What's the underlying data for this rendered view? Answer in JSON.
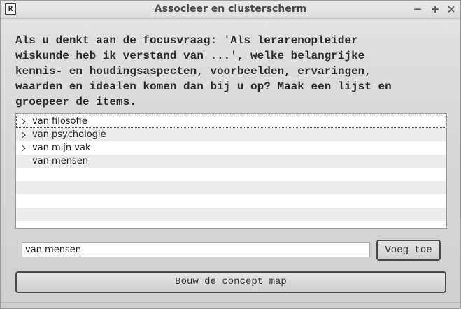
{
  "window": {
    "icon_glyph": "R",
    "title": "Associeer en clusterscherm",
    "controls": {
      "minimize": "−",
      "maximize": "+",
      "close": "×"
    }
  },
  "question": "Als u denkt aan de focusvraag: 'Als lerarenopleider\nwiskunde heb ik verstand van ...', welke belangrijke\nkennis- en houdingsaspecten, voorbeelden, ervaringen,\nwaarden en idealen komen dan bij u op? Maak een lijst en\ngroepeer de items.",
  "tree": {
    "items": [
      {
        "label": "van filosofie",
        "expandable": true,
        "selected": true
      },
      {
        "label": "van psychologie",
        "expandable": true,
        "selected": false
      },
      {
        "label": "van mijn vak",
        "expandable": true,
        "selected": false
      },
      {
        "label": "van mensen",
        "expandable": false,
        "selected": false
      }
    ]
  },
  "entry": {
    "value": "van mensen"
  },
  "buttons": {
    "add": "Voeg toe",
    "build_map": "Bouw de concept map"
  }
}
